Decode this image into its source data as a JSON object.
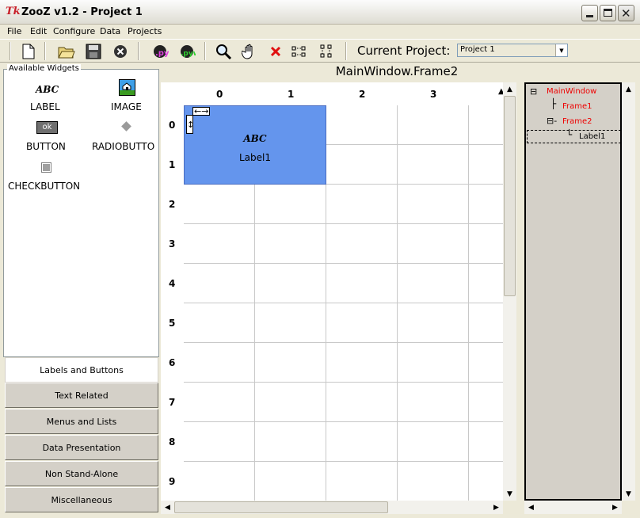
{
  "window": {
    "title": "ZooZ v1.2 - Project 1",
    "app_icon_text": "Tk"
  },
  "menubar": [
    "File",
    "Edit",
    "Configure",
    "Data",
    "Projects"
  ],
  "toolbar": {
    "project_label": "Current Project:",
    "project_value": "Project 1"
  },
  "left_panel": {
    "group_title": "Available Widgets",
    "widgets": [
      {
        "name": "LABEL",
        "preview": "ABC"
      },
      {
        "name": "IMAGE"
      },
      {
        "name": "BUTTON",
        "preview": "ok"
      },
      {
        "name": "RADIOBUTTO"
      },
      {
        "name": "CHECKBUTTON"
      }
    ],
    "categories": [
      "Labels and Buttons",
      "Text Related",
      "Menus and Lists",
      "Data Presentation",
      "Non Stand-Alone",
      "Miscellaneous"
    ],
    "active_category": "Labels and Buttons"
  },
  "center": {
    "title": "MainWindow.Frame2",
    "column_headers": [
      "0",
      "1",
      "2",
      "3"
    ],
    "row_headers": [
      "0",
      "1",
      "2",
      "3",
      "4",
      "5",
      "6",
      "7",
      "8",
      "9"
    ],
    "selected_widget": {
      "preview": "ABC",
      "name": "Label1",
      "h_resize": "←→",
      "v_resize": "↕"
    }
  },
  "tree": {
    "nodes": [
      {
        "label": "MainWindow",
        "expander": "⊟"
      },
      {
        "label": "Frame1",
        "connector": "├"
      },
      {
        "label": "Frame2",
        "expander": "⊟-"
      },
      {
        "label": "Label1",
        "connector": "└"
      }
    ]
  },
  "colors": {
    "selection": "#6495ed",
    "tree_text": "#e00000",
    "window_bg": "#ece9d8"
  }
}
